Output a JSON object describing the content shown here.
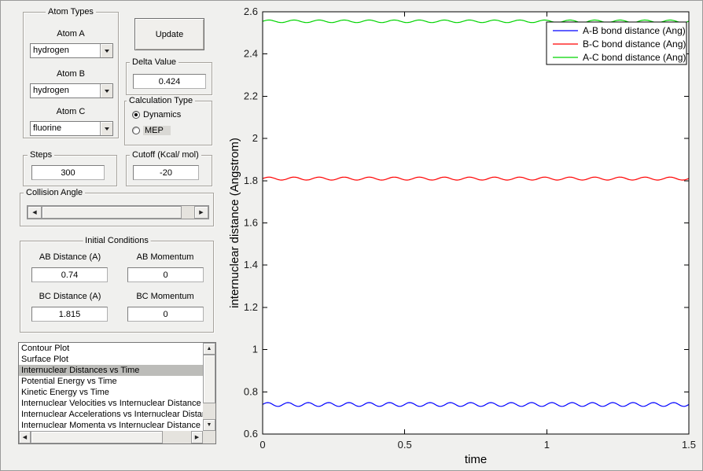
{
  "controls": {
    "atom_types": {
      "title": "Atom Types",
      "atom_a_label": "Atom A",
      "atom_a_value": "hydrogen",
      "atom_b_label": "Atom B",
      "atom_b_value": "hydrogen",
      "atom_c_label": "Atom C",
      "atom_c_value": "fluorine"
    },
    "update_button": "Update",
    "delta": {
      "title": "Delta Value",
      "value": "0.424"
    },
    "calculation_type": {
      "title": "Calculation Type",
      "options": [
        {
          "label": "Dynamics",
          "selected": true
        },
        {
          "label": "MEP",
          "selected": false
        }
      ]
    },
    "steps": {
      "title": "Steps",
      "value": "300"
    },
    "cutoff": {
      "title": "Cutoff (Kcal/ mol)",
      "value": "-20"
    },
    "collision_angle": {
      "title": "Collision Angle"
    },
    "initial_conditions": {
      "title": "Initial Conditions",
      "ab_distance_label": "AB Distance (A)",
      "ab_distance_value": "0.74",
      "ab_momentum_label": "AB Momentum",
      "ab_momentum_value": "0",
      "bc_distance_label": "BC Distance (A)",
      "bc_distance_value": "1.815",
      "bc_momentum_label": "BC Momentum",
      "bc_momentum_value": "0"
    },
    "plot_list": {
      "items": [
        "Contour Plot",
        "Surface Plot",
        "Internuclear Distances vs Time",
        "Potential Energy vs Time",
        "Kinetic Energy vs Time",
        "Internuclear Velocities vs Internuclear Distance",
        "Internuclear Accelerations vs Internuclear Distance",
        "Internuclear Momenta vs Internuclear Distance"
      ],
      "selected_index": 2
    }
  },
  "chart_data": {
    "type": "line",
    "title": "",
    "xlabel": "time",
    "ylabel": "internuclear distance (Angstrom)",
    "xlim": [
      0,
      1.5
    ],
    "ylim": [
      0.6,
      2.6
    ],
    "xticks": [
      0,
      0.5,
      1,
      1.5
    ],
    "yticks": [
      0.6,
      0.8,
      1,
      1.2,
      1.4,
      1.6,
      1.8,
      2,
      2.2,
      2.4,
      2.6
    ],
    "grid": false,
    "legend_position": "top-right",
    "series": [
      {
        "name": "A-B bond distance (Ang)",
        "color": "#0000ff",
        "mean": 0.74,
        "amplitude": 0.009,
        "cycles": 21
      },
      {
        "name": "B-C bond distance (Ang)",
        "color": "#ff0000",
        "mean": 1.81,
        "amplitude": 0.007,
        "cycles": 17
      },
      {
        "name": "A-C bond distance (Ang)",
        "color": "#00d400",
        "mean": 2.555,
        "amplitude": 0.006,
        "cycles": 17
      }
    ]
  }
}
